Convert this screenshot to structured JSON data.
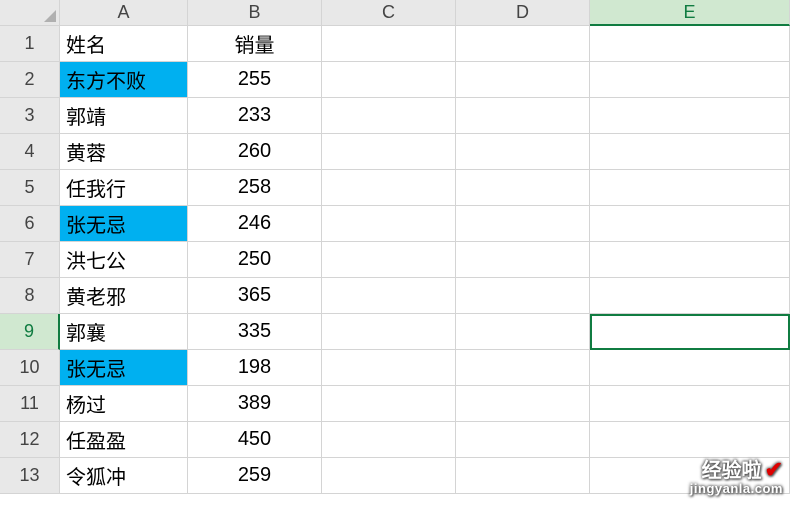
{
  "columns": [
    "A",
    "B",
    "C",
    "D",
    "E"
  ],
  "activeColumn": "E",
  "activeRow": 9,
  "rows": [
    {
      "n": 1,
      "A": "姓名",
      "B": "销量",
      "hlA": false
    },
    {
      "n": 2,
      "A": "东方不败",
      "B": "255",
      "hlA": true
    },
    {
      "n": 3,
      "A": "郭靖",
      "B": "233",
      "hlA": false
    },
    {
      "n": 4,
      "A": "黄蓉",
      "B": "260",
      "hlA": false
    },
    {
      "n": 5,
      "A": "任我行",
      "B": "258",
      "hlA": false
    },
    {
      "n": 6,
      "A": "张无忌",
      "B": "246",
      "hlA": true
    },
    {
      "n": 7,
      "A": "洪七公",
      "B": "250",
      "hlA": false
    },
    {
      "n": 8,
      "A": "黄老邪",
      "B": "365",
      "hlA": false
    },
    {
      "n": 9,
      "A": "郭襄",
      "B": "335",
      "hlA": false
    },
    {
      "n": 10,
      "A": "张无忌",
      "B": "198",
      "hlA": true
    },
    {
      "n": 11,
      "A": "杨过",
      "B": "389",
      "hlA": false
    },
    {
      "n": 12,
      "A": "任盈盈",
      "B": "450",
      "hlA": false
    },
    {
      "n": 13,
      "A": "令狐冲",
      "B": "259",
      "hlA": false
    }
  ],
  "watermark": {
    "top": "经验啦",
    "bottom": "jingyanla.com"
  }
}
